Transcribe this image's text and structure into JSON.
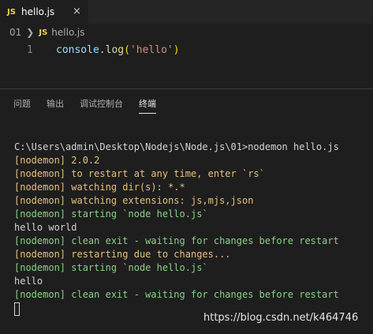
{
  "tab": {
    "icon": "JS",
    "filename": "hello.js",
    "close_glyph": "×"
  },
  "breadcrumb": {
    "folder": "01",
    "sep": "❯",
    "icon": "JS",
    "file": "hello.js"
  },
  "editor": {
    "line_number": "1",
    "code": {
      "obj": "console",
      "dot": ".",
      "fn": "log",
      "open": "(",
      "str": "'hello'",
      "close": ")"
    }
  },
  "panel_tabs": [
    "问题",
    "输出",
    "调试控制台",
    "终端"
  ],
  "terminal_lines": [
    {
      "text": "",
      "color": "#d4d4d4"
    },
    {
      "text": "C:\\Users\\admin\\Desktop\\Nodejs\\Node.js\\01>nodemon hello.js",
      "color": "#d4d4d4"
    },
    {
      "text": "[nodemon] 2.0.2",
      "color": "#e5c07b"
    },
    {
      "text": "[nodemon] to restart at any time, enter `rs`",
      "color": "#e5c07b"
    },
    {
      "text": "[nodemon] watching dir(s): *.*",
      "color": "#e5c07b"
    },
    {
      "text": "[nodemon] watching extensions: js,mjs,json",
      "color": "#e5c07b"
    },
    {
      "text": "[nodemon] starting `node hello.js`",
      "color": "#89d185"
    },
    {
      "text": "hello world",
      "color": "#d4d4d4"
    },
    {
      "text": "[nodemon] clean exit - waiting for changes before restart",
      "color": "#89d185"
    },
    {
      "text": "[nodemon] restarting due to changes...",
      "color": "#e5c07b"
    },
    {
      "text": "[nodemon] starting `node hello.js`",
      "color": "#89d185"
    },
    {
      "text": "hello",
      "color": "#d4d4d4"
    },
    {
      "text": "[nodemon] clean exit - waiting for changes before restart",
      "color": "#89d185"
    }
  ],
  "watermark": "https://blog.csdn.net/k464746"
}
